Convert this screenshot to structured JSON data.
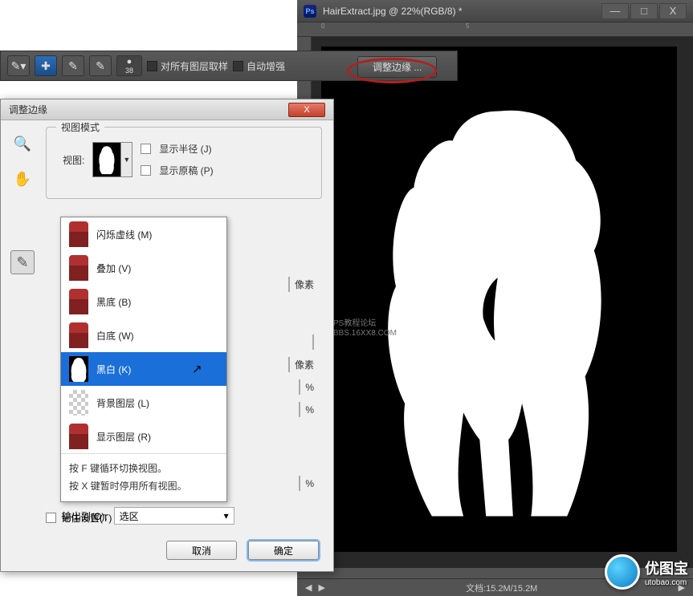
{
  "ps_window": {
    "title": "HairExtract.jpg @ 22%(RGB/8) *",
    "icon_label": "Ps",
    "min": "—",
    "max": "□",
    "close": "X",
    "status_center": "文档:15.2M/15.2M",
    "ruler_marks": [
      "0",
      "5"
    ]
  },
  "options_bar": {
    "brush_size": "38",
    "sample_all": "对所有图层取样",
    "auto_enhance": "自动增强",
    "refine_edge": "调整边缘 ..."
  },
  "dialog": {
    "title": "调整边缘",
    "close": "X",
    "viewmode": {
      "legend": "视图模式",
      "view_label": "视图:",
      "show_radius": "显示半径 (J)",
      "show_original": "显示原稿 (P)"
    },
    "units": {
      "px": "像素",
      "pct": "%"
    },
    "dropdown": {
      "items": [
        {
          "label": "闪烁虚线 (M)",
          "thumb": "red-person"
        },
        {
          "label": "叠加 (V)",
          "thumb": "red-person"
        },
        {
          "label": "黑底 (B)",
          "thumb": "red-person"
        },
        {
          "label": "白底 (W)",
          "thumb": "red-person"
        },
        {
          "label": "黑白 (K)",
          "thumb": "bw",
          "selected": true
        },
        {
          "label": "背景图层 (L)",
          "thumb": "checker"
        },
        {
          "label": "显示图层 (R)",
          "thumb": "red-person"
        }
      ],
      "footer1": "按 F 键循环切换视图。",
      "footer2": "按 X 键暂时停用所有视图。"
    },
    "output": {
      "label": "输出到(O):",
      "value": "选区"
    },
    "remember": "记住设置(T)",
    "cancel": "取消",
    "ok": "确定"
  },
  "watermark": {
    "line1": "PS教程论坛",
    "line2": "BBS.16XX8.COM"
  },
  "logo": {
    "text": "优图宝",
    "sub": "utobao.com"
  }
}
